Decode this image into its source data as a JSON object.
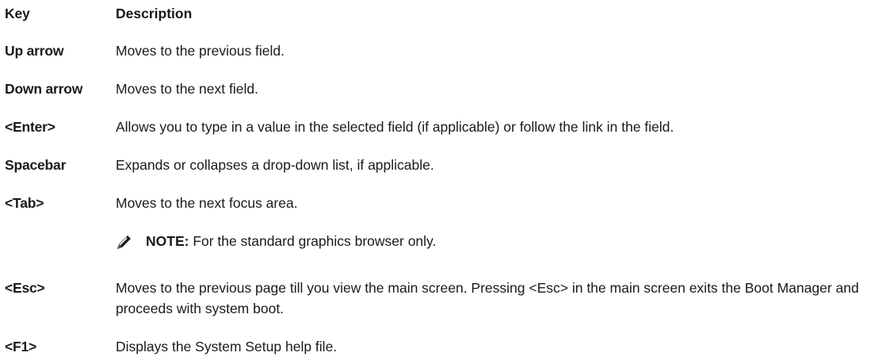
{
  "table": {
    "header": {
      "key": "Key",
      "description": "Description"
    },
    "rows": [
      {
        "key": "Up arrow",
        "description": "Moves to the previous field."
      },
      {
        "key": "Down arrow",
        "description": "Moves to the next field."
      },
      {
        "key": "<Enter>",
        "description": "Allows you to type in a value in the selected field (if applicable) or follow the link in the field."
      },
      {
        "key": "Spacebar",
        "description": "Expands or collapses a drop-down list, if applicable."
      },
      {
        "key": "<Tab>",
        "description": "Moves to the next focus area."
      },
      {
        "key": "<Esc>",
        "description": "Moves to the previous page till you view the main screen. Pressing <Esc> in the main screen exits the Boot Manager and proceeds with system boot."
      },
      {
        "key": "<F1>",
        "description": "Displays the System Setup help file."
      }
    ],
    "note": {
      "icon": "pencil-note-icon",
      "label": "NOTE:",
      "text": " For the standard graphics browser only."
    }
  }
}
